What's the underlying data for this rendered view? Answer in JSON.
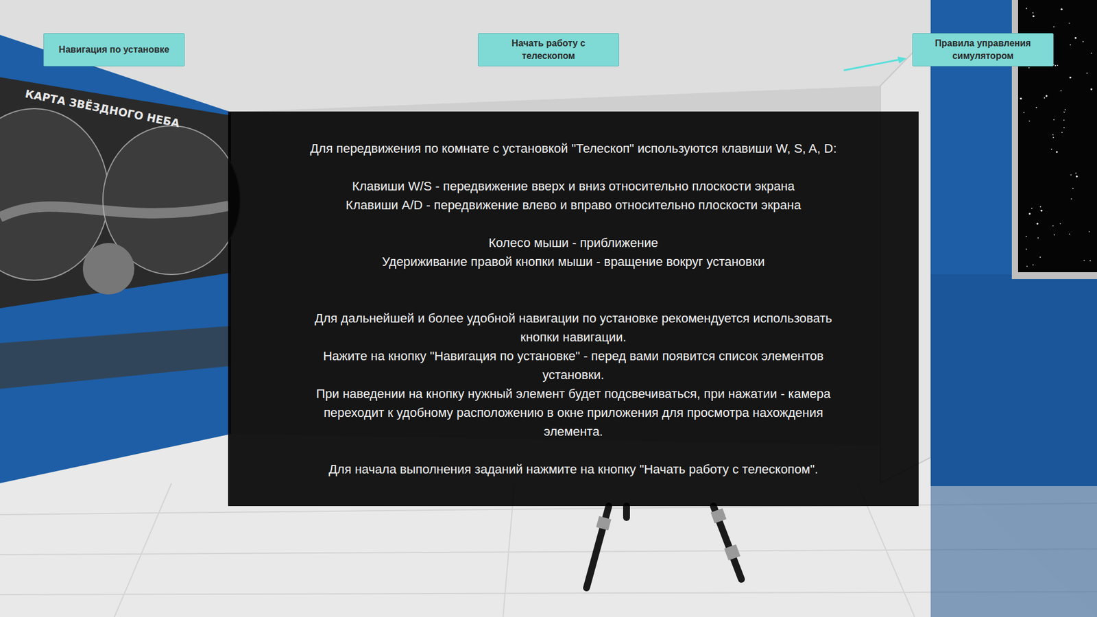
{
  "poster": {
    "title": "КАРТА ЗВЁЗДНОГО НЕБА"
  },
  "buttons": [
    {
      "lines": [
        "Навигация по установке"
      ]
    },
    {
      "lines": [
        "Начать работу с",
        "телескопом"
      ]
    },
    {
      "lines": [
        "Правила управления",
        "симулятором"
      ]
    }
  ],
  "panel": {
    "paragraphs": [
      [
        "Для передвижения по комнате с установкой \"Телескоп\" используются клавиши W, S, A, D:"
      ],
      [
        "Клавиши W/S - передвижение вверх и вниз относительно плоскости экрана",
        "Клавиши A/D - передвижение влево и вправо относительно плоскости экрана"
      ],
      [
        "Колесо мыши - приближение",
        "Удериживание правой кнопки мыши - вращение вокруг установки"
      ],
      [
        "Для дальнейшей и более удобной навигации по установке рекомендуется использовать",
        "кнопки навигации.",
        "Нажите на кнопку \"Навигация по установке\" - перед вами появится список элементов",
        "установки.",
        "При наведении на кнопку нужный элемент будет подсвечиваться, при нажатии - камера",
        "переходит к удобному расположению в окне приложения для просмотра нахождения",
        "элемента."
      ],
      [
        "Для начала выполнения заданий нажмите на кнопку \"Начать работу с телескопом\"."
      ]
    ]
  }
}
